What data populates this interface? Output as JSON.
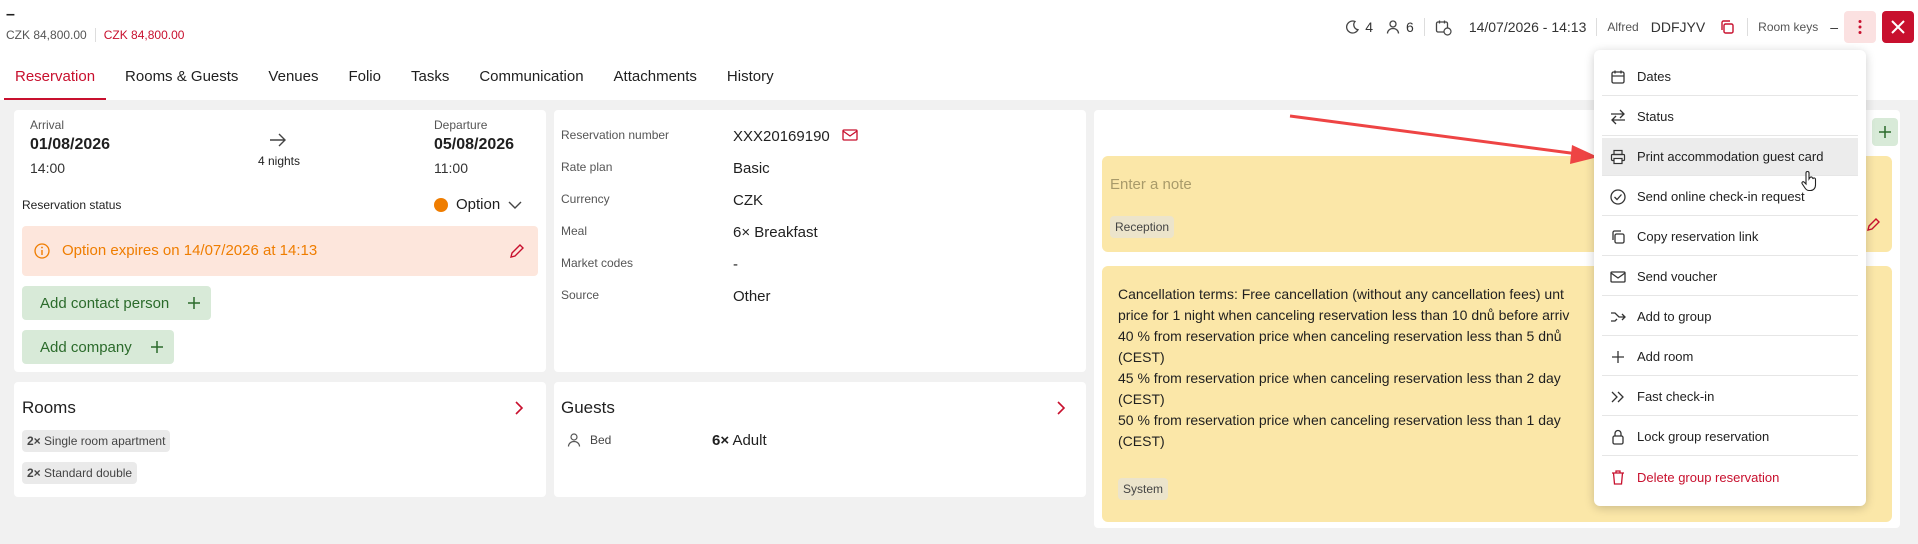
{
  "header": {
    "title": "–",
    "price_total": "CZK 84,800.00",
    "price_due": "CZK 84,800.00",
    "nights_count": "4",
    "guests_count": "6",
    "created": "14/07/2026 - 14:13",
    "user": "Alfred",
    "code": "DDFJYV",
    "room_keys": "Room keys",
    "room_keys_value": "–"
  },
  "tabs": [
    "Reservation",
    "Rooms & Guests",
    "Venues",
    "Folio",
    "Tasks",
    "Communication",
    "Attachments",
    "History"
  ],
  "stay": {
    "arrival_label": "Arrival",
    "arrival_date": "01/08/2026",
    "arrival_time": "14:00",
    "nights": "4 nights",
    "departure_label": "Departure",
    "departure_date": "05/08/2026",
    "departure_time": "11:00",
    "status_label": "Reservation status",
    "status_value": "Option",
    "option_text": "Option expires on 14/07/2026 at 14:13",
    "add_contact": "Add contact person",
    "add_company": "Add company"
  },
  "details": {
    "rows": [
      {
        "label": "Reservation number",
        "value": "XXX20169190"
      },
      {
        "label": "Rate plan",
        "value": "Basic"
      },
      {
        "label": "Currency",
        "value": "CZK"
      },
      {
        "label": "Meal",
        "value": "6× Breakfast"
      },
      {
        "label": "Market codes",
        "value": "-"
      },
      {
        "label": "Source",
        "value": "Other"
      }
    ]
  },
  "rooms": {
    "title": "Rooms",
    "items": [
      {
        "count": "2×",
        "name": "Single room apartment"
      },
      {
        "count": "2×",
        "name": "Standard double"
      }
    ]
  },
  "guests": {
    "title": "Guests",
    "bed_label": "Bed",
    "count": "6×",
    "type": "Adult"
  },
  "notes": {
    "placeholder": "Enter a note",
    "reception_tag": "Reception",
    "system_tag": "System",
    "cancellation_lines": [
      "Cancellation terms: Free cancellation (without any cancellation fees) unt",
      "price for 1 night when canceling reservation less than 10 dnů before arriv",
      "40 % from reservation price when canceling reservation less than 5 dnů",
      "(CEST)",
      "45 % from reservation price when canceling reservation less than 2 day",
      "(CEST)",
      "50 % from reservation price when canceling reservation less than 1 day",
      "(CEST)"
    ]
  },
  "menu": {
    "items": [
      {
        "label": "Dates",
        "icon": "calendar-icon"
      },
      {
        "label": "Status",
        "icon": "swap-icon"
      },
      {
        "label": "Print accommodation guest card",
        "icon": "printer-icon"
      },
      {
        "label": "Send online check-in request",
        "icon": "check-circle-icon"
      },
      {
        "label": "Copy reservation link",
        "icon": "copy-icon"
      },
      {
        "label": "Send voucher",
        "icon": "envelope-icon"
      },
      {
        "label": "Add to group",
        "icon": "group-arrow-icon"
      },
      {
        "label": "Add room",
        "icon": "plus-icon"
      },
      {
        "label": "Fast check-in",
        "icon": "double-chevron-icon"
      },
      {
        "label": "Lock group reservation",
        "icon": "lock-icon"
      },
      {
        "label": "Delete group reservation",
        "icon": "trash-icon"
      }
    ]
  },
  "colors": {
    "accent": "#c8102e",
    "option_orange": "#ef7d00",
    "option_banner": "#fde6dc",
    "note_yellow": "#fbe7a8",
    "green_button": "#d8ead8"
  }
}
